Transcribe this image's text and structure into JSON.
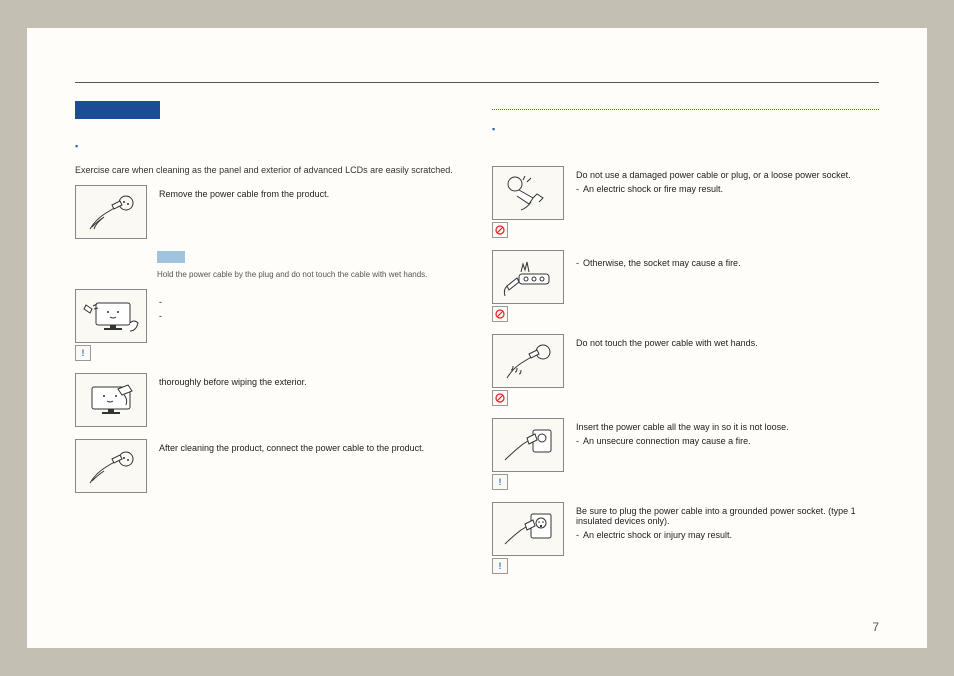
{
  "page_number": "7",
  "left": {
    "intro": "Exercise care when cleaning as the panel and exterior of advanced LCDs are easily scratched.",
    "step0_text": "Remove the power cable from the product.",
    "step0_note": "Hold the power cable by the plug and do not touch the cable with wet hands.",
    "step1_dash": "-",
    "step1_dash2": "-",
    "step2_text": "thoroughly before wiping the exterior.",
    "step3_text": "After cleaning the product, connect the power cable to the product."
  },
  "right": {
    "r0_text": "Do not use a damaged power cable or plug, or a loose power socket.",
    "r0_sub": "An electric shock or fire may result.",
    "r1_sub": "Otherwise, the socket may cause a fire.",
    "r2_text": "Do not touch the power cable with wet hands.",
    "r3_text": "Insert the power cable all the way in so it is not loose.",
    "r3_sub": "An unsecure connection may cause a fire.",
    "r4_text": "Be sure to plug the power cable into a grounded power socket. (type 1 insulated devices only).",
    "r4_sub": "An electric shock or injury may result."
  },
  "dash": "-"
}
